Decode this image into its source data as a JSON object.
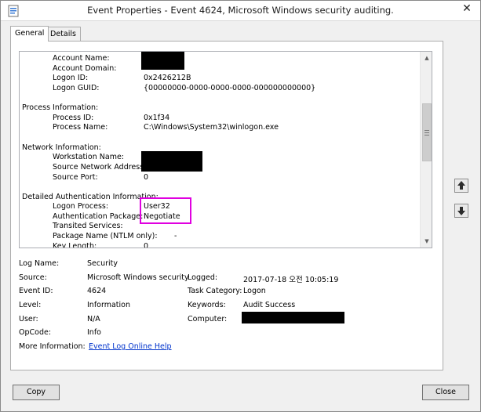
{
  "window": {
    "title": "Event Properties - Event 4624, Microsoft Windows security auditing.",
    "close_label": "✕"
  },
  "tabs": [
    {
      "label": "General"
    },
    {
      "label": "Details"
    }
  ],
  "description": {
    "lines": {
      "account_name": "Account Name:",
      "account_domain": "Account Domain:",
      "logon_id_label": "Logon ID:",
      "logon_id_value": "0x2426212B",
      "logon_guid_label": "Logon GUID:",
      "logon_guid_value": "{00000000-0000-0000-0000-000000000000}",
      "process_info": "Process Information:",
      "process_id_label": "Process ID:",
      "process_id_value": "0x1f34",
      "process_name_label": "Process Name:",
      "process_name_value": "C:\\Windows\\System32\\winlogon.exe",
      "network_info": "Network Information:",
      "workstation_name": "Workstation Name:",
      "source_network_address": "Source Network Address:",
      "source_port_label": "Source Port:",
      "source_port_value": "0",
      "detailed_auth": "Detailed Authentication Information:",
      "logon_process_label": "Logon Process:",
      "logon_process_value": "User32",
      "auth_package_label": "Authentication Package:",
      "auth_package_value": "Negotiate",
      "transited_services": "Transited Services:",
      "package_name_label": "Package Name (NTLM only):",
      "package_name_value": "-",
      "key_length_label": "Key Length:",
      "key_length_value": "0"
    }
  },
  "fields": {
    "log_name_label": "Log Name:",
    "log_name_value": "Security",
    "source_label": "Source:",
    "source_value": "Microsoft Windows security",
    "logged_label": "Logged:",
    "logged_value": "2017-07-18 오전 10:05:19",
    "event_id_label": "Event ID:",
    "event_id_value": "4624",
    "task_category_label": "Task Category:",
    "task_category_value": "Logon",
    "level_label": "Level:",
    "level_value": "Information",
    "keywords_label": "Keywords:",
    "keywords_value": "Audit Success",
    "user_label": "User:",
    "user_value": "N/A",
    "computer_label": "Computer:",
    "opcode_label": "OpCode:",
    "opcode_value": "Info",
    "more_info_label": "More Information:",
    "more_info_link": "Event Log Online Help"
  },
  "buttons": {
    "copy": "Copy",
    "close": "Close"
  },
  "colors": {
    "highlight_border": "#e000e0",
    "link": "#0033cc"
  },
  "icons": {
    "window": "event-viewer-icon",
    "previous": "arrow-up-icon",
    "next": "arrow-down-icon"
  }
}
